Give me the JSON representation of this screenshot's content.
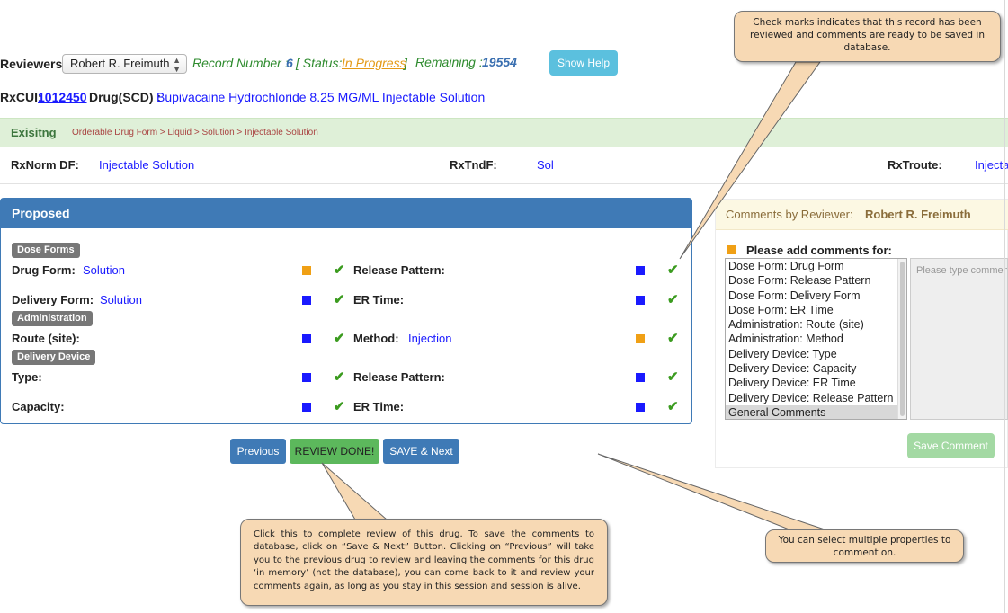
{
  "header": {
    "reviewers_label": "Reviewers:",
    "reviewer_selected": "Robert R. Freimuth",
    "record_number_label": "Record Number :",
    "record_number": "6",
    "status_open": "[ Status:",
    "status_value": "In Progress",
    "status_close": "]",
    "remaining_label": "Remaining :",
    "remaining_value": "19554",
    "show_help": "Show Help",
    "rxcui_label": "RxCUI:",
    "rxcui_value": "1012450",
    "drug_label": "Drug(SCD) :",
    "drug_value": "Bupivacaine Hydrochloride 8.25 MG/ML Injectable Solution"
  },
  "existing": {
    "title": "Exisitng",
    "path": "Orderable Drug Form > Liquid > Solution > Injectable Solution",
    "rxnorm_df_label": "RxNorm DF:",
    "rxnorm_df_value": "Injectable Solution",
    "rxtndf_label": "RxTndF:",
    "rxtndf_value": "Sol",
    "rxtroute_label": "RxTroute:",
    "rxtroute_value": "Injecta"
  },
  "proposed": {
    "title": "Proposed",
    "badges": {
      "dose_forms": "Dose Forms",
      "administration": "Administration",
      "delivery_device": "Delivery Device"
    },
    "rows": {
      "drug_form": {
        "label": "Drug Form:",
        "value": "Solution"
      },
      "release_pattern_1": {
        "label": "Release Pattern:",
        "value": ""
      },
      "delivery_form": {
        "label": "Delivery Form:",
        "value": "Solution"
      },
      "er_time_1": {
        "label": "ER Time:",
        "value": ""
      },
      "route_site": {
        "label": "Route (site):",
        "value": ""
      },
      "method": {
        "label": "Method:",
        "value": "Injection"
      },
      "type": {
        "label": "Type:",
        "value": ""
      },
      "release_pattern_2": {
        "label": "Release Pattern:",
        "value": ""
      },
      "capacity": {
        "label": "Capacity:",
        "value": ""
      },
      "er_time_2": {
        "label": "ER Time:",
        "value": ""
      }
    },
    "check_glyph": "✔"
  },
  "comments": {
    "header_label": "Comments by Reviewer:",
    "reviewer": "Robert R. Freimuth",
    "add_label": "Please add comments for:",
    "options": [
      "Dose Form: Drug Form",
      "Dose Form: Release Pattern",
      "Dose Form: Delivery Form",
      "Dose Form: ER Time",
      "Administration: Route (site)",
      "Administration: Method",
      "Delivery Device: Type",
      "Delivery Device: Capacity",
      "Delivery Device: ER Time",
      "Delivery Device: Release Pattern",
      "General Comments"
    ],
    "selected_option": "General Comments",
    "textarea_placeholder": "Please type comment",
    "save_comment": "Save Comment"
  },
  "buttons": {
    "previous": "Previous",
    "review_done": "REVIEW DONE!",
    "save_next": "SAVE & Next"
  },
  "callouts": {
    "check_marks": "Check marks indicates that this record has been reviewed and comments are ready to be saved in database.",
    "review_done": "Click this to complete review of this drug. To save the comments to database, click on “Save & Next” Button.  Clicking on “Previous” will take you to the previous drug to review and leaving the comments for this drug ‘in memory’ (not the database), you can come back to it and review your comments again, as long as you stay in this session and session is alive.",
    "multi_select": "You can select multiple properties to comment on."
  },
  "colors": {
    "primary": "#3f7ab6",
    "success": "#5cb85c",
    "info": "#5bc0de",
    "status_orange": "#e49a16",
    "value_blue": "#1a1aff",
    "callout_fill": "#f7d9b4"
  }
}
